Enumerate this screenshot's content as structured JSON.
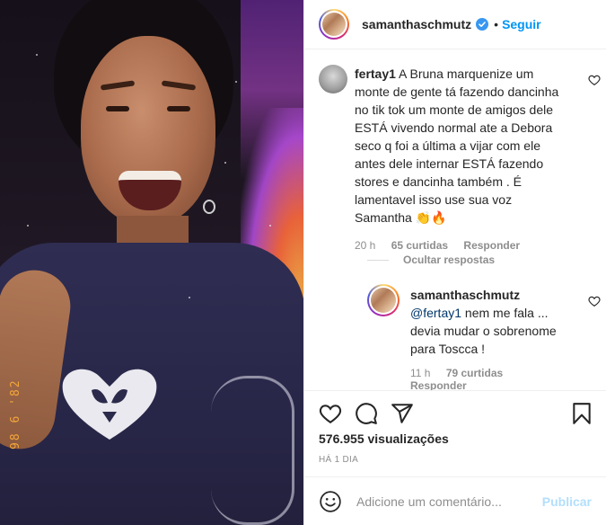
{
  "media": {
    "datestamp": "98 6 '82"
  },
  "post": {
    "username": "samanthaschmutz",
    "separator": "•",
    "follow_label": "Seguir"
  },
  "comments": [
    {
      "username": "fertay1",
      "text": "A Bruna marquenize um monte de gente tá fazendo dancinha no tik tok um monte de amigos dele ESTÁ vivendo normal ate a Debora seco q foi a última a vijar com ele antes dele internar ESTÁ fazendo stores e dancinha também . É lamentavel isso use sua voz Samantha 👏🔥",
      "time": "20 h",
      "likes": "65 curtidas",
      "reply_label": "Responder"
    }
  ],
  "hide_replies_label": "Ocultar respostas",
  "replies": [
    {
      "username": "samanthaschmutz",
      "mention": "@fertay1",
      "text": " nem me fala ... devia mudar o sobrenome para Toscca !",
      "time": "11 h",
      "likes": "79 curtidas",
      "reply_label": "Responder"
    }
  ],
  "stats": {
    "views": "576.955 visualizações",
    "time_ago": "HÁ 1 DIA"
  },
  "add_comment": {
    "placeholder": "Adicione um comentário...",
    "publish_label": "Publicar"
  },
  "colors": {
    "accent": "#0095f6",
    "publish_disabled": "#b2dffc",
    "muted_text": "#8e8e8e"
  }
}
